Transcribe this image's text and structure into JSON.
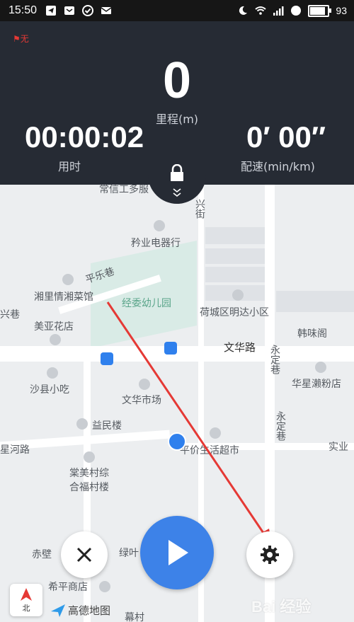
{
  "status_bar": {
    "time": "15:50",
    "battery": "93",
    "battery_fraction": 0.93
  },
  "gps_badge": "无",
  "stats": {
    "distance_value": "0",
    "distance_label": "里程(m)",
    "duration_value": "00:00:02",
    "duration_label": "用时",
    "pace_value": "0′ 00″",
    "pace_label": "配速(min/km)"
  },
  "map_labels": {
    "top_cut": "常信工多服",
    "jiefang_st": "兴街",
    "yuye": "矜业电器行",
    "pingle": "平乐巷",
    "xiangli": "湘里情湘菜馆",
    "kindergarten": "经委幼儿园",
    "mingda": "荷城区明达小区",
    "xing_alley": "兴巷",
    "meiya": "美亚花店",
    "hanweige": "韩味阁",
    "wenhua_rd": "文华路",
    "yongding_1": "永定巷",
    "huaxing": "华星濑粉店",
    "shaxian": "沙县小吃",
    "wenhua_market": "文华市场",
    "yongding_2": "永定巷",
    "yimin": "益民楼",
    "pingjia": "平价生活超市",
    "shiye": "实业",
    "xinghe_rd": "星河路",
    "tangmei_1": "棠美村综",
    "tangmei_2": "合福村楼",
    "chibi": "赤壁",
    "lvye": "绿叶",
    "xiping": "希平商店",
    "xingcun": "幕村"
  },
  "controls": {
    "close": "close-icon",
    "start": "play-icon",
    "settings": "gear-icon",
    "lock": "lock-icon",
    "expand": "chevron-down-icon"
  },
  "compass_label": "北",
  "map_brand": "高德地图",
  "watermark": "Bai 经验",
  "colors": {
    "panel": "#262b34",
    "accent": "#3d82e8",
    "location": "#2f80ed",
    "arrow": "#e53935"
  }
}
